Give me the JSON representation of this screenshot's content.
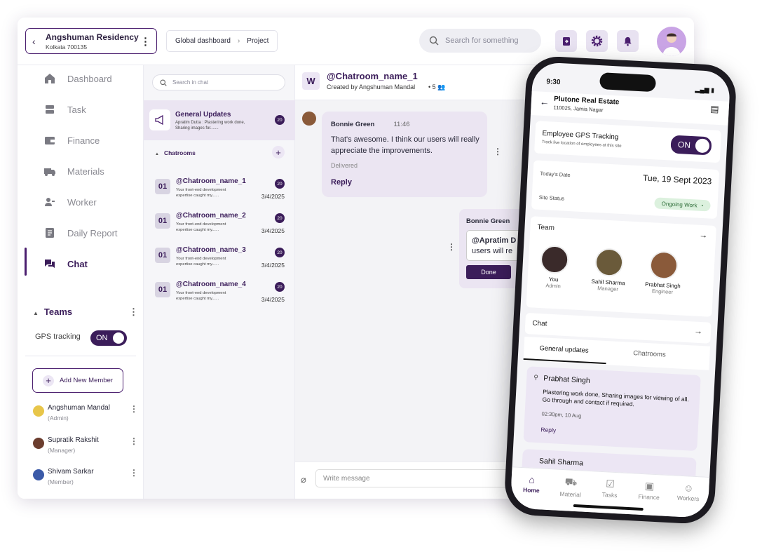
{
  "header": {
    "project_name": "Angshuman Residency",
    "project_city": "Kolkata 700135",
    "breadcrumb": [
      "Global dashboard",
      "Project"
    ],
    "search_placeholder": "Search for something"
  },
  "sidebar": {
    "items": [
      {
        "label": "Dashboard",
        "icon": "home-icon"
      },
      {
        "label": "Task",
        "icon": "task-icon"
      },
      {
        "label": "Finance",
        "icon": "wallet-icon"
      },
      {
        "label": "Materials",
        "icon": "truck-icon"
      },
      {
        "label": "Worker",
        "icon": "worker-icon"
      },
      {
        "label": "Daily Report",
        "icon": "report-icon"
      },
      {
        "label": "Chat",
        "icon": "chat-icon",
        "active": true
      }
    ],
    "teams_label": "Teams",
    "gps_label": "GPS tracking",
    "gps_toggle": "ON",
    "add_member": "Add New Member",
    "members": [
      {
        "name": "Angshuman Mandal",
        "role": "(Admin)"
      },
      {
        "name": "Supratik Rakshit",
        "role": "(Manager)"
      },
      {
        "name": "Shivam Sarkar",
        "role": "(Member)"
      }
    ]
  },
  "chatlist": {
    "search_placeholder": "Search in chat",
    "general": {
      "title": "General Updates",
      "preview": "Apratim Dutta : Plastering work done, Sharing images for.......",
      "count": "20"
    },
    "chatrooms_label": "Chatrooms",
    "rooms": [
      {
        "num": "01",
        "name": "@Chatroom_name_1",
        "preview": "Your front-end development expertise caught my......",
        "date": "3/4/2025",
        "count": "20"
      },
      {
        "num": "01",
        "name": "@Chatroom_name_2",
        "preview": "Your front-end development expertise caught my......",
        "date": "3/4/2025",
        "count": "20"
      },
      {
        "num": "01",
        "name": "@Chatroom_name_3",
        "preview": "Your front-end development expertise caught my......",
        "date": "3/4/2025",
        "count": "20"
      },
      {
        "num": "01",
        "name": "@Chatroom_name_4",
        "preview": "Your front-end development expertise caught my......",
        "date": "3/4/2025",
        "count": "20"
      }
    ]
  },
  "chat": {
    "initial": "W",
    "title": "@Chatroom_name_1",
    "subtitle": "Created by Angshuman Mandal",
    "members": "5",
    "message1": {
      "sender": "Bonnie Green",
      "time": "11:46",
      "text": "That's awesome. I think our users will really appreciate the improvements.",
      "status": "Delivered",
      "reply": "Reply"
    },
    "message2": {
      "sender": "Bonnie Green",
      "mention": "@Apratim D",
      "text": "users will re",
      "done": "Done"
    },
    "composer_placeholder": "Write message"
  },
  "phone": {
    "time": "9:30",
    "company": "Plutone Real Estate",
    "address": "110025, Jamia Nagar",
    "gps_title": "Employee GPS Tracking",
    "gps_sub": "Track live location of employees at this site",
    "gps_toggle": "ON",
    "date_label": "Today's Date",
    "date_value": "Tue, 19 Sept 2023",
    "status_label": "Site Status",
    "status_value": "Ongoing Work",
    "team_label": "Team",
    "team": [
      {
        "name": "You",
        "role": "Admin"
      },
      {
        "name": "Sahil Sharma",
        "role": "Manager"
      },
      {
        "name": "Prabhat Singh",
        "role": "Engineer"
      }
    ],
    "chat_label": "Chat",
    "tab1": "General updates",
    "tab2": "Chatrooms",
    "post": {
      "name": "Prabhat Singh",
      "text": "Plastering work done, Sharing images for viewing of all. Go through and contact if required.",
      "time": "02:30pm, 10 Aug",
      "reply": "Reply"
    },
    "post2_name": "Sahil Sharma",
    "tabbar": [
      "Home",
      "Material",
      "Tasks",
      "Finance",
      "Workers"
    ]
  }
}
